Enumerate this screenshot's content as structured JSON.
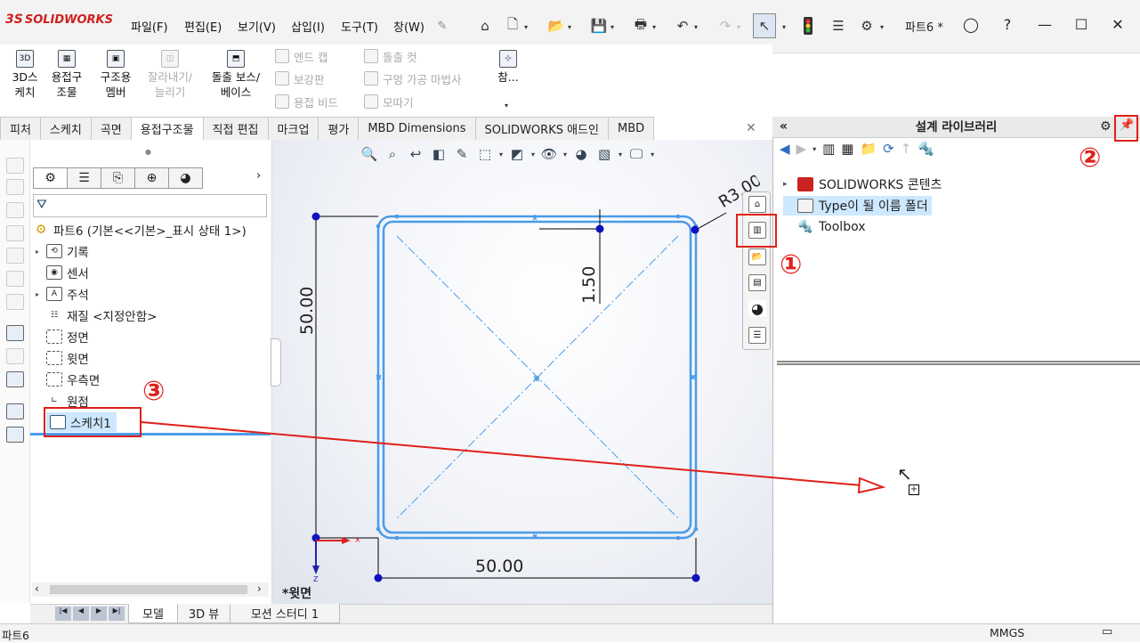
{
  "app": {
    "logo_ds": "3S",
    "logo_text": "SOLIDWORKS",
    "document_title": "파트6 *"
  },
  "menu": [
    "파일(F)",
    "편집(E)",
    "보기(V)",
    "삽입(I)",
    "도구(T)",
    "창(W)"
  ],
  "commands": {
    "sketch3d": [
      "3D스",
      "케치"
    ],
    "weldment": [
      "용접구",
      "조물"
    ],
    "structural_member": [
      "구조용",
      "멤버"
    ],
    "trim_extend": [
      "잘라내기/",
      "늘리기"
    ],
    "extrude_boss": [
      "돌출 보스/",
      "베이스"
    ],
    "end_cap": "엔드 캡",
    "gusset": "보강판",
    "weld_bead": "용접 비드",
    "extruded_cut": "돌출 컷",
    "hole_wizard": "구멍 가공 마법사",
    "chamfer": "모따기",
    "reference": "참..."
  },
  "tabs": [
    "피처",
    "스케치",
    "곡면",
    "용접구조물",
    "직접 편집",
    "마크업",
    "평가",
    "MBD Dimensions",
    "SOLIDWORKS 애드인",
    "MBD"
  ],
  "active_tab": "용접구조물",
  "feature_tree": {
    "root": "파트6  (기본<<기본>_표시 상태 1>)",
    "items": [
      {
        "label": "기록",
        "icon": "history-icon",
        "expandable": true
      },
      {
        "label": "센서",
        "icon": "sensor-icon",
        "expandable": false
      },
      {
        "label": "주석",
        "icon": "annotation-icon",
        "expandable": true
      },
      {
        "label": "재질 <지정안함>",
        "icon": "material-icon",
        "expandable": false
      },
      {
        "label": "정면",
        "icon": "plane-icon",
        "expandable": false
      },
      {
        "label": "윗면",
        "icon": "plane-icon",
        "expandable": false
      },
      {
        "label": "우측면",
        "icon": "plane-icon",
        "expandable": false
      },
      {
        "label": "원점",
        "icon": "origin-icon",
        "expandable": false
      },
      {
        "label": "스케치1",
        "icon": "sketch-icon",
        "expandable": false,
        "selected": true
      }
    ]
  },
  "sketch": {
    "dim_height": "50.00",
    "dim_width": "50.00",
    "dim_thickness": "1.50",
    "dim_radius": "R3.00",
    "view_label": "*윗면"
  },
  "bottom_tabs": [
    "모델",
    "3D 뷰",
    "모션 스터디 1"
  ],
  "status": {
    "left": "파트6",
    "units": "MMGS"
  },
  "design_library": {
    "title": "설계 라이브러리",
    "items": [
      {
        "label": "SOLIDWORKS 콘텐츠",
        "expandable": true
      },
      {
        "label": "Type이 될 이름 폴더",
        "expandable": false,
        "selected": true
      },
      {
        "label": "Toolbox",
        "expandable": false
      }
    ]
  },
  "annotations": {
    "marker1": "①",
    "marker2": "②",
    "marker3": "③"
  },
  "colors": {
    "sketch": "#4a9be8",
    "annotation": "#e0201a",
    "selection": "#cde8ff",
    "brand": "#d02020"
  }
}
